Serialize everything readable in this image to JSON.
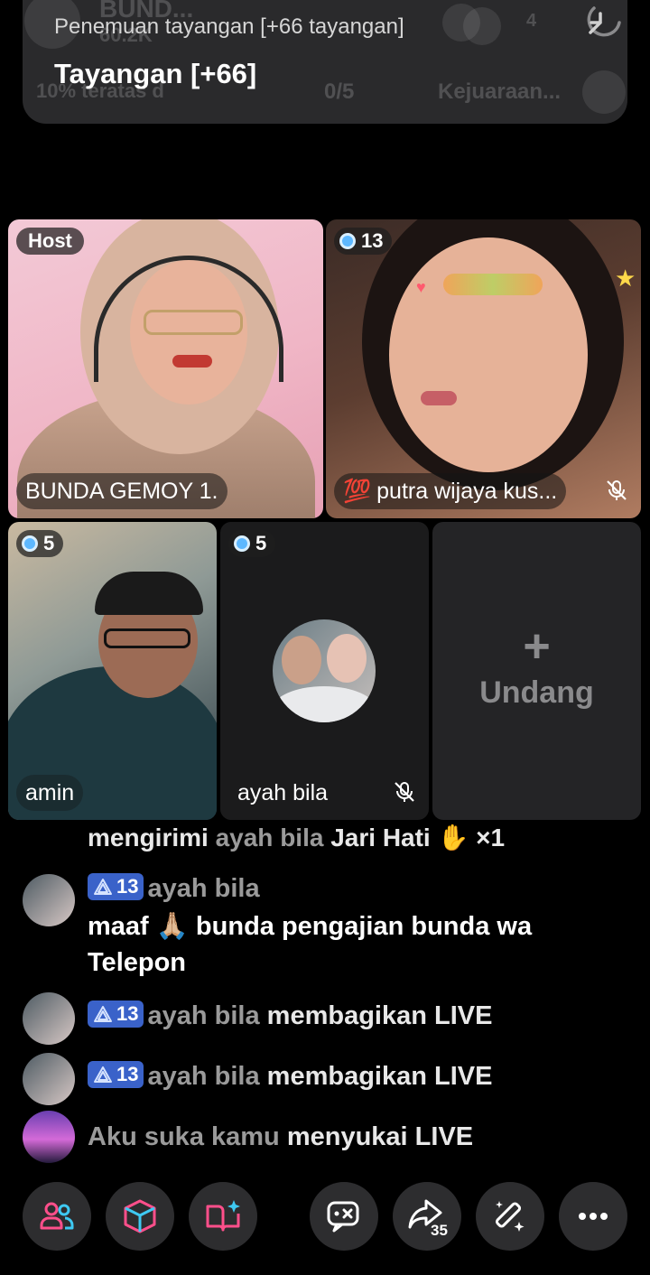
{
  "banner": {
    "subtitle": "Penemuan tayangan [+66 tayangan]",
    "title": "Tayangan [+66]",
    "ghost_name": "BUND...",
    "ghost_score": "60.2K",
    "ghost_rank": "10% teratas d",
    "ghost_progress": "0/5",
    "ghost_champion": "Kejuaraan...",
    "ghost_count": "4"
  },
  "grid": {
    "host": {
      "badge": "Host",
      "name": "BUNDA GEMOY 1."
    },
    "guest1": {
      "level": "13",
      "emoji": "💯",
      "name": "putra wijaya kus..."
    },
    "guest2": {
      "level": "5",
      "name": "amin"
    },
    "guest3": {
      "level": "5",
      "name": "ayah bila"
    },
    "invite": {
      "plus": "+",
      "label": "Undang"
    }
  },
  "comments": {
    "cut_line": {
      "prefix": "mengirimi ",
      "user": "ayah bila",
      "gift": " Jari Hati ",
      "count": "×1"
    },
    "items": [
      {
        "level": "13",
        "user": "ayah bila",
        "action": "",
        "message": "maaf 🙏🏼 bunda pengajian bunda wa Telepon"
      },
      {
        "level": "13",
        "user": "ayah bila",
        "action": "membagikan LIVE"
      },
      {
        "level": "13",
        "user": "ayah bila",
        "action": "membagikan LIVE"
      },
      {
        "user": "Aku suka kamu",
        "action": "menyukai LIVE"
      }
    ]
  },
  "bottom_bar": {
    "share_count": "35",
    "icons": [
      "people-icon",
      "cube-icon",
      "book-sparkle-icon",
      "chat-x-icon",
      "share-icon",
      "magic-wand-icon",
      "more-icon"
    ]
  },
  "colors": {
    "badge_blue": "#3a62c9",
    "level_blue": "#5db8ff",
    "accent_pink": "#fe2c55",
    "accent_cyan": "#25f4ee"
  }
}
